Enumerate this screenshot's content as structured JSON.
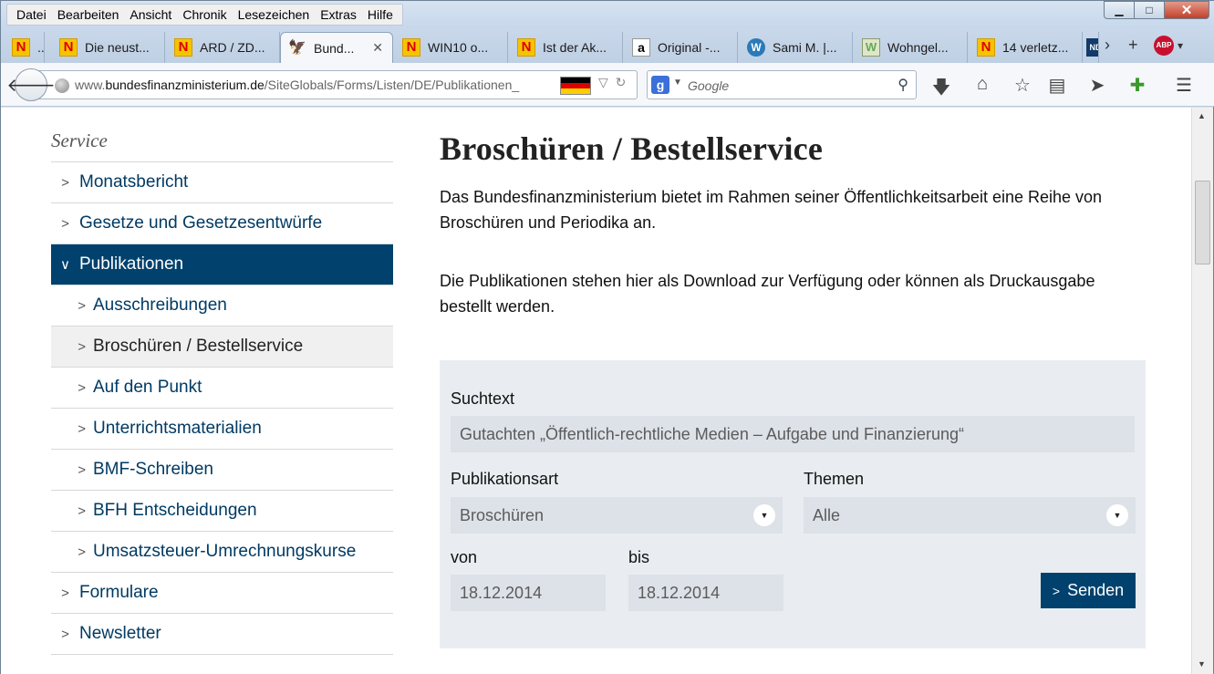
{
  "menu": [
    "Datei",
    "Bearbeiten",
    "Ansicht",
    "Chronik",
    "Lesezeichen",
    "Extras",
    "Hilfe"
  ],
  "window_controls": {
    "minimize": "▁",
    "maximize": "□",
    "close": "✕"
  },
  "tabs": [
    {
      "title": "..",
      "icon": "n-icon"
    },
    {
      "title": "Die neust...",
      "icon": "n-icon"
    },
    {
      "title": "ARD / ZD...",
      "icon": "n-icon"
    },
    {
      "title": "Bund...",
      "icon": "eagle-icon",
      "active": true
    },
    {
      "title": "WIN10 o...",
      "icon": "n-icon"
    },
    {
      "title": "Ist der Ak...",
      "icon": "n-icon"
    },
    {
      "title": "Original -...",
      "icon": "amazon-icon"
    },
    {
      "title": "Sami M. |...",
      "icon": "wordpress-icon"
    },
    {
      "title": "Wohngel...",
      "icon": "w-icon"
    },
    {
      "title": "14 verletz...",
      "icon": "n-icon"
    },
    {
      "title": "",
      "icon": "nd-icon"
    }
  ],
  "tab_icons": {
    "n": "N",
    "amazon": "a",
    "wordpress": "W",
    "w": "W",
    "nd": "ND",
    "eagle": "🦅"
  },
  "tab_buttons": {
    "scroll_right": "›",
    "new_tab": "+",
    "adblock": "ABP",
    "dropdown": "▾"
  },
  "urlbar": {
    "prefix": "www.",
    "domain": "bundesfinanzministerium.de",
    "path": "/SiteGlobals/Forms/Listen/DE/Publikationen_",
    "flag_colors": [
      "#000000",
      "#dd0000",
      "#ffce00"
    ]
  },
  "search": {
    "engine_glyph": "g",
    "placeholder": "Google"
  },
  "toolbar_icons": [
    "download-icon",
    "home-icon",
    "bookmark-star-icon",
    "reader-icon",
    "send-icon",
    "puzzle-icon",
    "hamburger-menu-icon"
  ],
  "sidebar": {
    "heading": "Service",
    "items": [
      {
        "label": "Monatsbericht",
        "level": 0
      },
      {
        "label": "Gesetze und Gesetzesentwürfe",
        "level": 0
      },
      {
        "label": "Publikationen",
        "level": 0,
        "state": "active"
      },
      {
        "label": "Ausschreibungen",
        "level": 1
      },
      {
        "label": "Broschüren / Bestellservice",
        "level": 1,
        "state": "current"
      },
      {
        "label": "Auf den Punkt",
        "level": 1
      },
      {
        "label": "Unterrichtsmaterialien",
        "level": 1
      },
      {
        "label": "BMF-Schreiben",
        "level": 1
      },
      {
        "label": "BFH Entscheidungen",
        "level": 1
      },
      {
        "label": "Umsatzsteuer-Umrechnungskurse",
        "level": 1
      },
      {
        "label": "Formulare",
        "level": 0
      },
      {
        "label": "Newsletter",
        "level": 0
      }
    ]
  },
  "main": {
    "title": "Broschüren / Bestellservice",
    "intro1": "Das Bundesfinanzministerium bietet im Rahmen seiner Öffentlichkeitsarbeit eine Reihe von Broschüren und Periodika an.",
    "intro2": "Die Publikationen stehen hier als Download zur Verfügung oder können als Druckausgabe bestellt werden."
  },
  "form": {
    "suchtext_label": "Suchtext",
    "suchtext_value": "Gutachten „Öffentlich-rechtliche Medien – Aufgabe und Finanzierung“",
    "publikationsart_label": "Publikationsart",
    "publikationsart_value": "Broschüren",
    "themen_label": "Themen",
    "themen_value": "Alle",
    "von_label": "von",
    "von_value": "18.12.2014",
    "bis_label": "bis",
    "bis_value": "18.12.2014",
    "submit_label": "Senden"
  },
  "colors": {
    "primary": "#00416d",
    "link": "#003a63",
    "form_bg": "#e9edf1",
    "field_bg": "#dde2e8"
  }
}
